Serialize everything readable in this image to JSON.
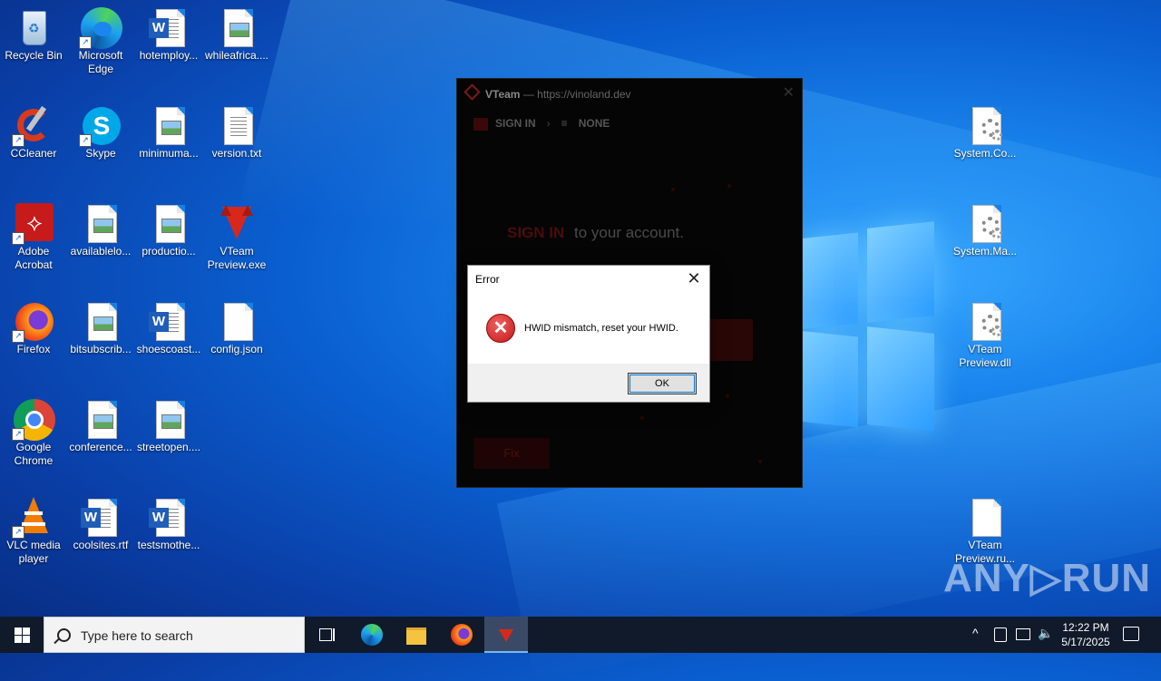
{
  "desktop": {
    "icons": [
      {
        "label": "Recycle Bin",
        "icon": "recycle-bin-icon"
      },
      {
        "label": "Microsoft Edge",
        "icon": "edge-icon"
      },
      {
        "label": "hotemploy...",
        "icon": "word-doc-icon"
      },
      {
        "label": "whileafrica....",
        "icon": "image-file-icon"
      },
      {
        "label": "CCleaner",
        "icon": "ccleaner-icon"
      },
      {
        "label": "Skype",
        "icon": "skype-icon"
      },
      {
        "label": "minimuma...",
        "icon": "image-file-icon"
      },
      {
        "label": "version.txt",
        "icon": "text-file-icon"
      },
      {
        "label": "Adobe Acrobat",
        "icon": "acrobat-icon"
      },
      {
        "label": "availablelo...",
        "icon": "image-file-icon"
      },
      {
        "label": "productio...",
        "icon": "image-file-icon"
      },
      {
        "label": "VTeam Preview.exe",
        "icon": "vteam-fox-icon"
      },
      {
        "label": "Firefox",
        "icon": "firefox-icon"
      },
      {
        "label": "bitsubscrib...",
        "icon": "image-file-icon"
      },
      {
        "label": "shoescoast...",
        "icon": "word-doc-icon"
      },
      {
        "label": "config.json",
        "icon": "blank-file-icon"
      },
      {
        "label": "Google Chrome",
        "icon": "chrome-icon"
      },
      {
        "label": "conference...",
        "icon": "image-file-icon"
      },
      {
        "label": "streetopen....",
        "icon": "image-file-icon"
      },
      {
        "label": "VLC media player",
        "icon": "vlc-icon"
      },
      {
        "label": "coolsites.rtf",
        "icon": "word-doc-icon"
      },
      {
        "label": "testsmothe...",
        "icon": "word-doc-icon"
      },
      {
        "label": "System.Co...",
        "icon": "settings-file-icon"
      },
      {
        "label": "System.Ma...",
        "icon": "settings-file-icon"
      },
      {
        "label": "VTeam Preview.dll",
        "icon": "settings-file-icon"
      },
      {
        "label": "VTeam Preview.ru...",
        "icon": "blank-file-icon"
      }
    ]
  },
  "app": {
    "brand": "VTeam",
    "title_sep": "—",
    "url": "https://vinoland.dev",
    "close": "✕",
    "nav_signin": "SIGN IN",
    "nav_arrow": "›",
    "nav_menu_icon": "≡",
    "nav_none": "NONE",
    "heading_accent": "SIGN IN",
    "heading_rest": "to your account.",
    "fix_button": "Fix"
  },
  "dialog": {
    "title": "Error",
    "close": "✕",
    "icon_glyph": "✕",
    "message": "HWID mismatch, reset your HWID.",
    "ok_label": "OK"
  },
  "taskbar": {
    "search_placeholder": "Type here to search",
    "time": "12:22 PM",
    "date": "5/17/2025",
    "tray_chevron": "^"
  },
  "watermark": "ANY▷RUN"
}
